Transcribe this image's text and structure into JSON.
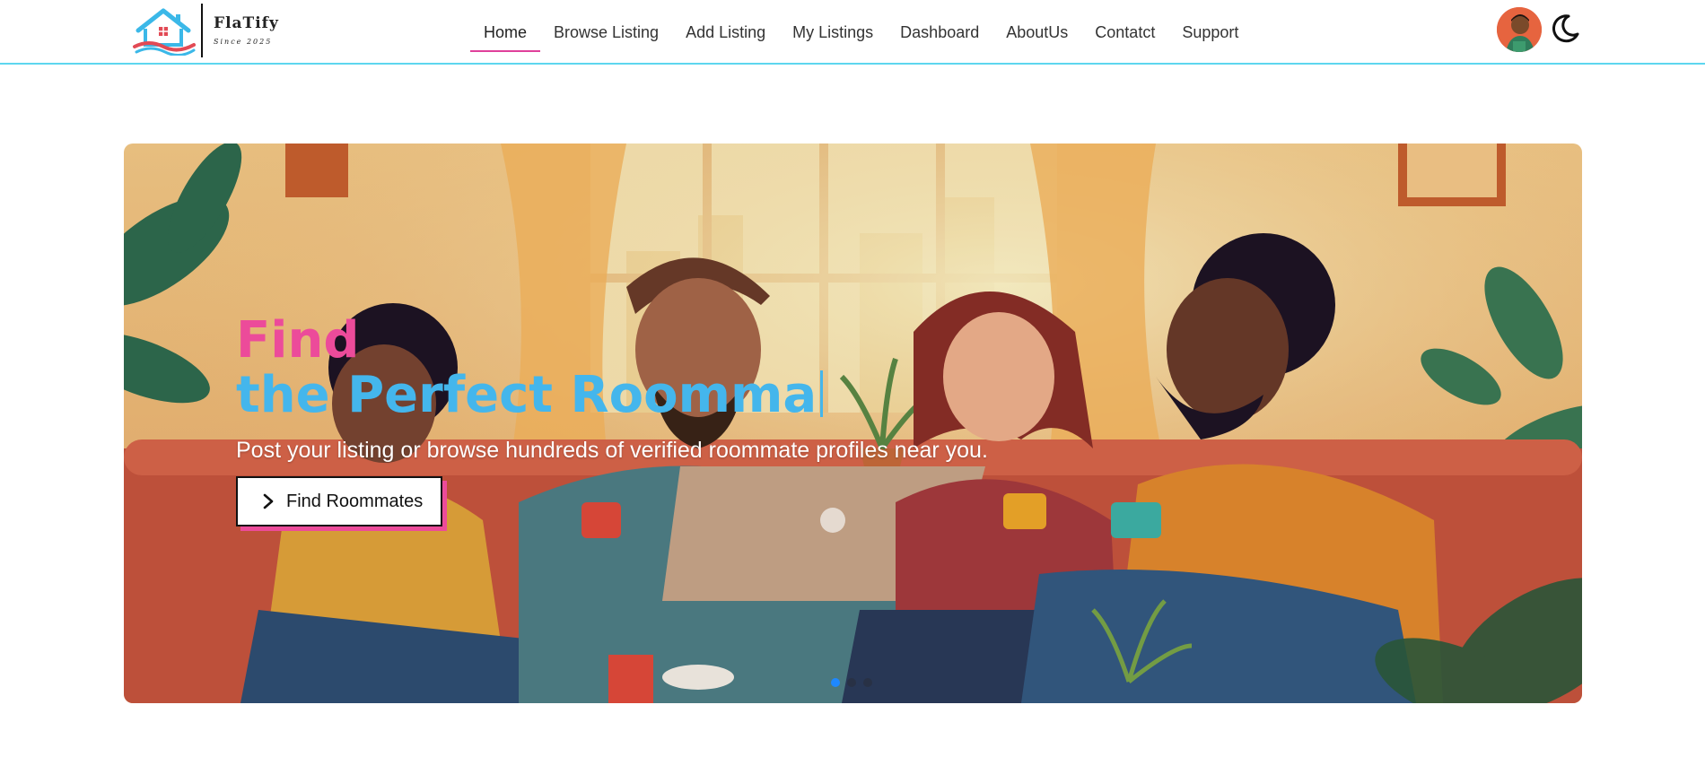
{
  "brand": {
    "name": "FlaTify",
    "since": "Since 2025"
  },
  "nav": {
    "items": [
      {
        "label": "Home",
        "active": true
      },
      {
        "label": "Browse Listing",
        "active": false
      },
      {
        "label": "Add Listing",
        "active": false
      },
      {
        "label": "My Listings",
        "active": false
      },
      {
        "label": "Dashboard",
        "active": false
      },
      {
        "label": "AboutUs",
        "active": false
      },
      {
        "label": "Contatct",
        "active": false
      },
      {
        "label": "Support",
        "active": false
      }
    ]
  },
  "user": {
    "avatar_icon": "user-avatar"
  },
  "theme_toggle": {
    "icon": "moon-icon"
  },
  "hero": {
    "title_line1": "Find",
    "title_line2": "the Perfect Roomma",
    "subtitle": "Post your listing or browse hundreds of verified roommate profiles near you.",
    "cta_label": "Find Roommates",
    "cta_icon": "chevron-right-icon",
    "slides_count": 3,
    "active_slide": 1
  },
  "colors": {
    "accent_pink": "#ec4b9a",
    "accent_blue": "#44b6ec",
    "navbar_border": "#5dd6ef",
    "active_dot": "#1e88ff"
  }
}
